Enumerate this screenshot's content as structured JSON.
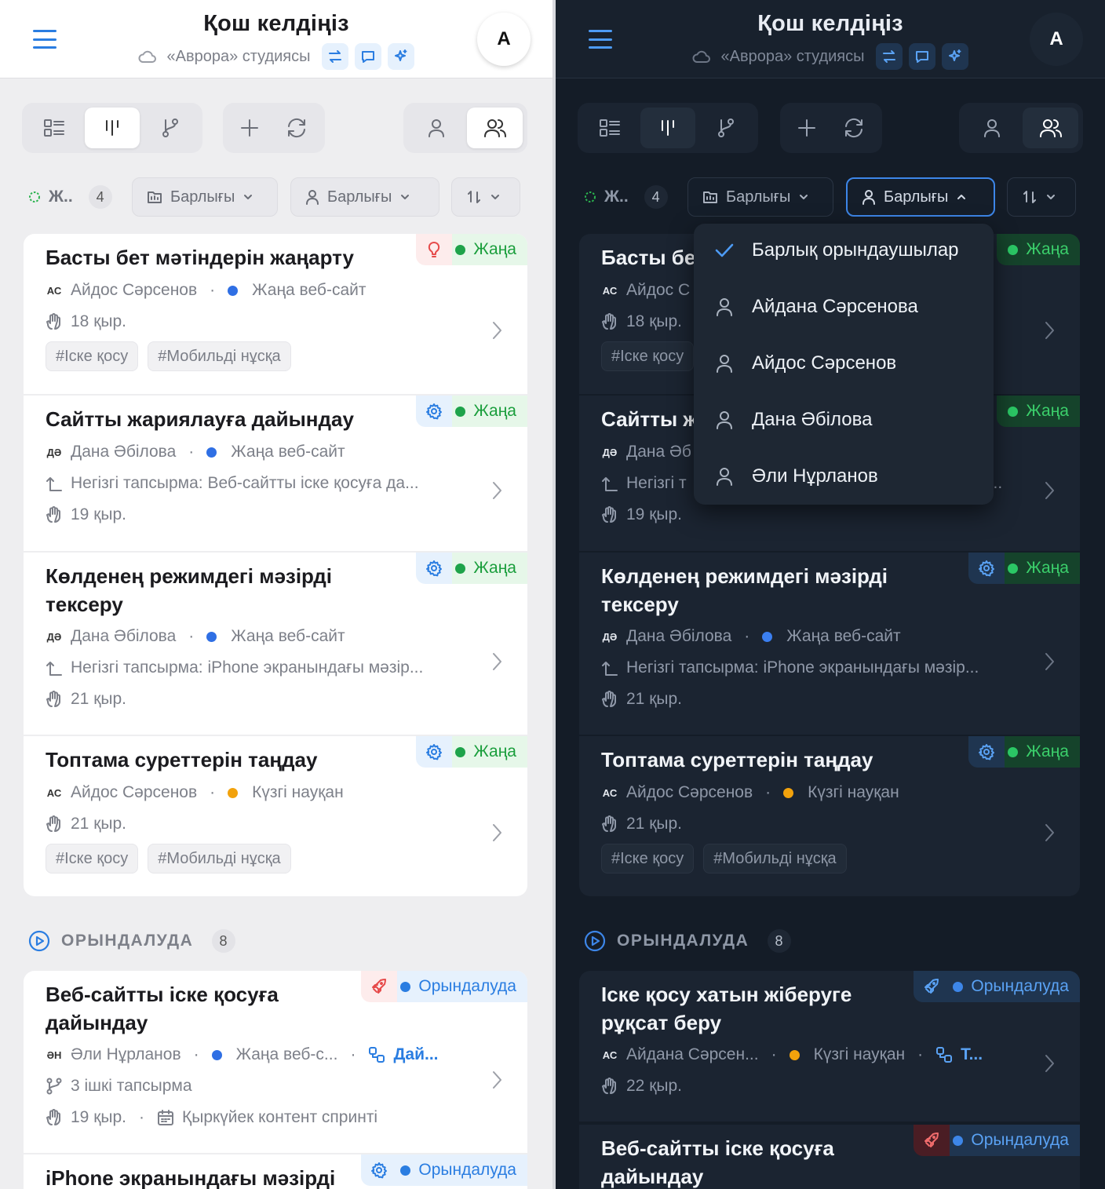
{
  "header": {
    "title": "Қош келдіңіз",
    "workspace": "«Аврора» студиясы",
    "avatar_letter": "А"
  },
  "filters": {
    "status_short": "Ж..",
    "status_count": "4",
    "project_filter": "Барлығы",
    "assignee_filter": "Барлығы"
  },
  "new_tasks": [
    {
      "title": "Басты бет мәтіндерін жаңарту",
      "badge": "Жаңа",
      "assignee_initials": "АС",
      "assignee": "Айдос Сәрсенов",
      "project": "Жаңа веб-сайт",
      "due": "18 қыр.",
      "tags": [
        "#Іске қосу",
        "#Мобильді нұсқа"
      ]
    },
    {
      "title": "Сайтты жариялауға дайындау",
      "badge": "Жаңа",
      "assignee_initials": "ДӘ",
      "assignee": "Дана Әбілова",
      "project": "Жаңа веб-сайт",
      "parent": "Негізгі тапсырма: Веб-сайтты іске қосуға да...",
      "due": "19 қыр."
    },
    {
      "title_line1": "Көлденең режимдегі мәзірді",
      "title_line2": "тексеру",
      "badge": "Жаңа",
      "assignee_initials": "ДӘ",
      "assignee": "Дана Әбілова",
      "project": "Жаңа веб-сайт",
      "parent": "Негізгі тапсырма: iPhone экранындағы мәзір...",
      "due": "21 қыр."
    },
    {
      "title": "Топтама суреттерін таңдау",
      "badge": "Жаңа",
      "assignee_initials": "АС",
      "assignee": "Айдос Сәрсенов",
      "project": "Күзгі науқан",
      "due": "21 қыр.",
      "tags": [
        "#Іске қосу",
        "#Мобильді нұсқа"
      ]
    }
  ],
  "in_progress": {
    "label": "ОРЫНДАЛУДА",
    "count": "8",
    "badge": "Орындалуда",
    "light_cards": [
      {
        "title_line1": "Веб-сайтты іске қосуға",
        "title_line2": "дайындау",
        "assignee_initials": "ӘН",
        "assignee": "Әли Нұрланов",
        "project": "Жаңа веб-с...",
        "link": "Дай...",
        "subtasks": "3 ішкі тапсырма",
        "due": "19 қыр.",
        "sprint": "Қыркүйек контент спринті"
      },
      {
        "title": "iPhone экранындағы мәзірді"
      }
    ],
    "dark_cards": [
      {
        "title_line1": "Іске қосу хатын жіберуге",
        "title_line2": "рұқсат беру",
        "assignee_initials": "АС",
        "assignee": "Айдана Сәрсен...",
        "project": "Күзгі науқан",
        "link": "Т...",
        "due": "22 қыр."
      },
      {
        "title_line1": "Веб-сайтты іске қосуға",
        "title_line2": "дайындау"
      }
    ]
  },
  "dark_truncated": {
    "card1_title": "Басты бе",
    "card1_assignee": "Айдос С",
    "card1_tag": "#Іске қосу",
    "card2_title": "Сайтты ж",
    "card2_assignee": "Дана Әб",
    "card2_parent": "Негізгі т",
    "card2_parent_tail": "а..."
  },
  "assignee_dropdown": {
    "items": [
      "Барлық орындаушылар",
      "Айдана Сәрсенова",
      "Айдос Сәрсенов",
      "Дана Әбілова",
      "Әли Нұрланов"
    ],
    "selected": "Барлық орындаушылар"
  },
  "colors": {
    "accent": "#2a7de1",
    "new_green": "#1a9e3c",
    "project_blue": "#2f6fe4",
    "project_orange": "#f2a20c"
  }
}
